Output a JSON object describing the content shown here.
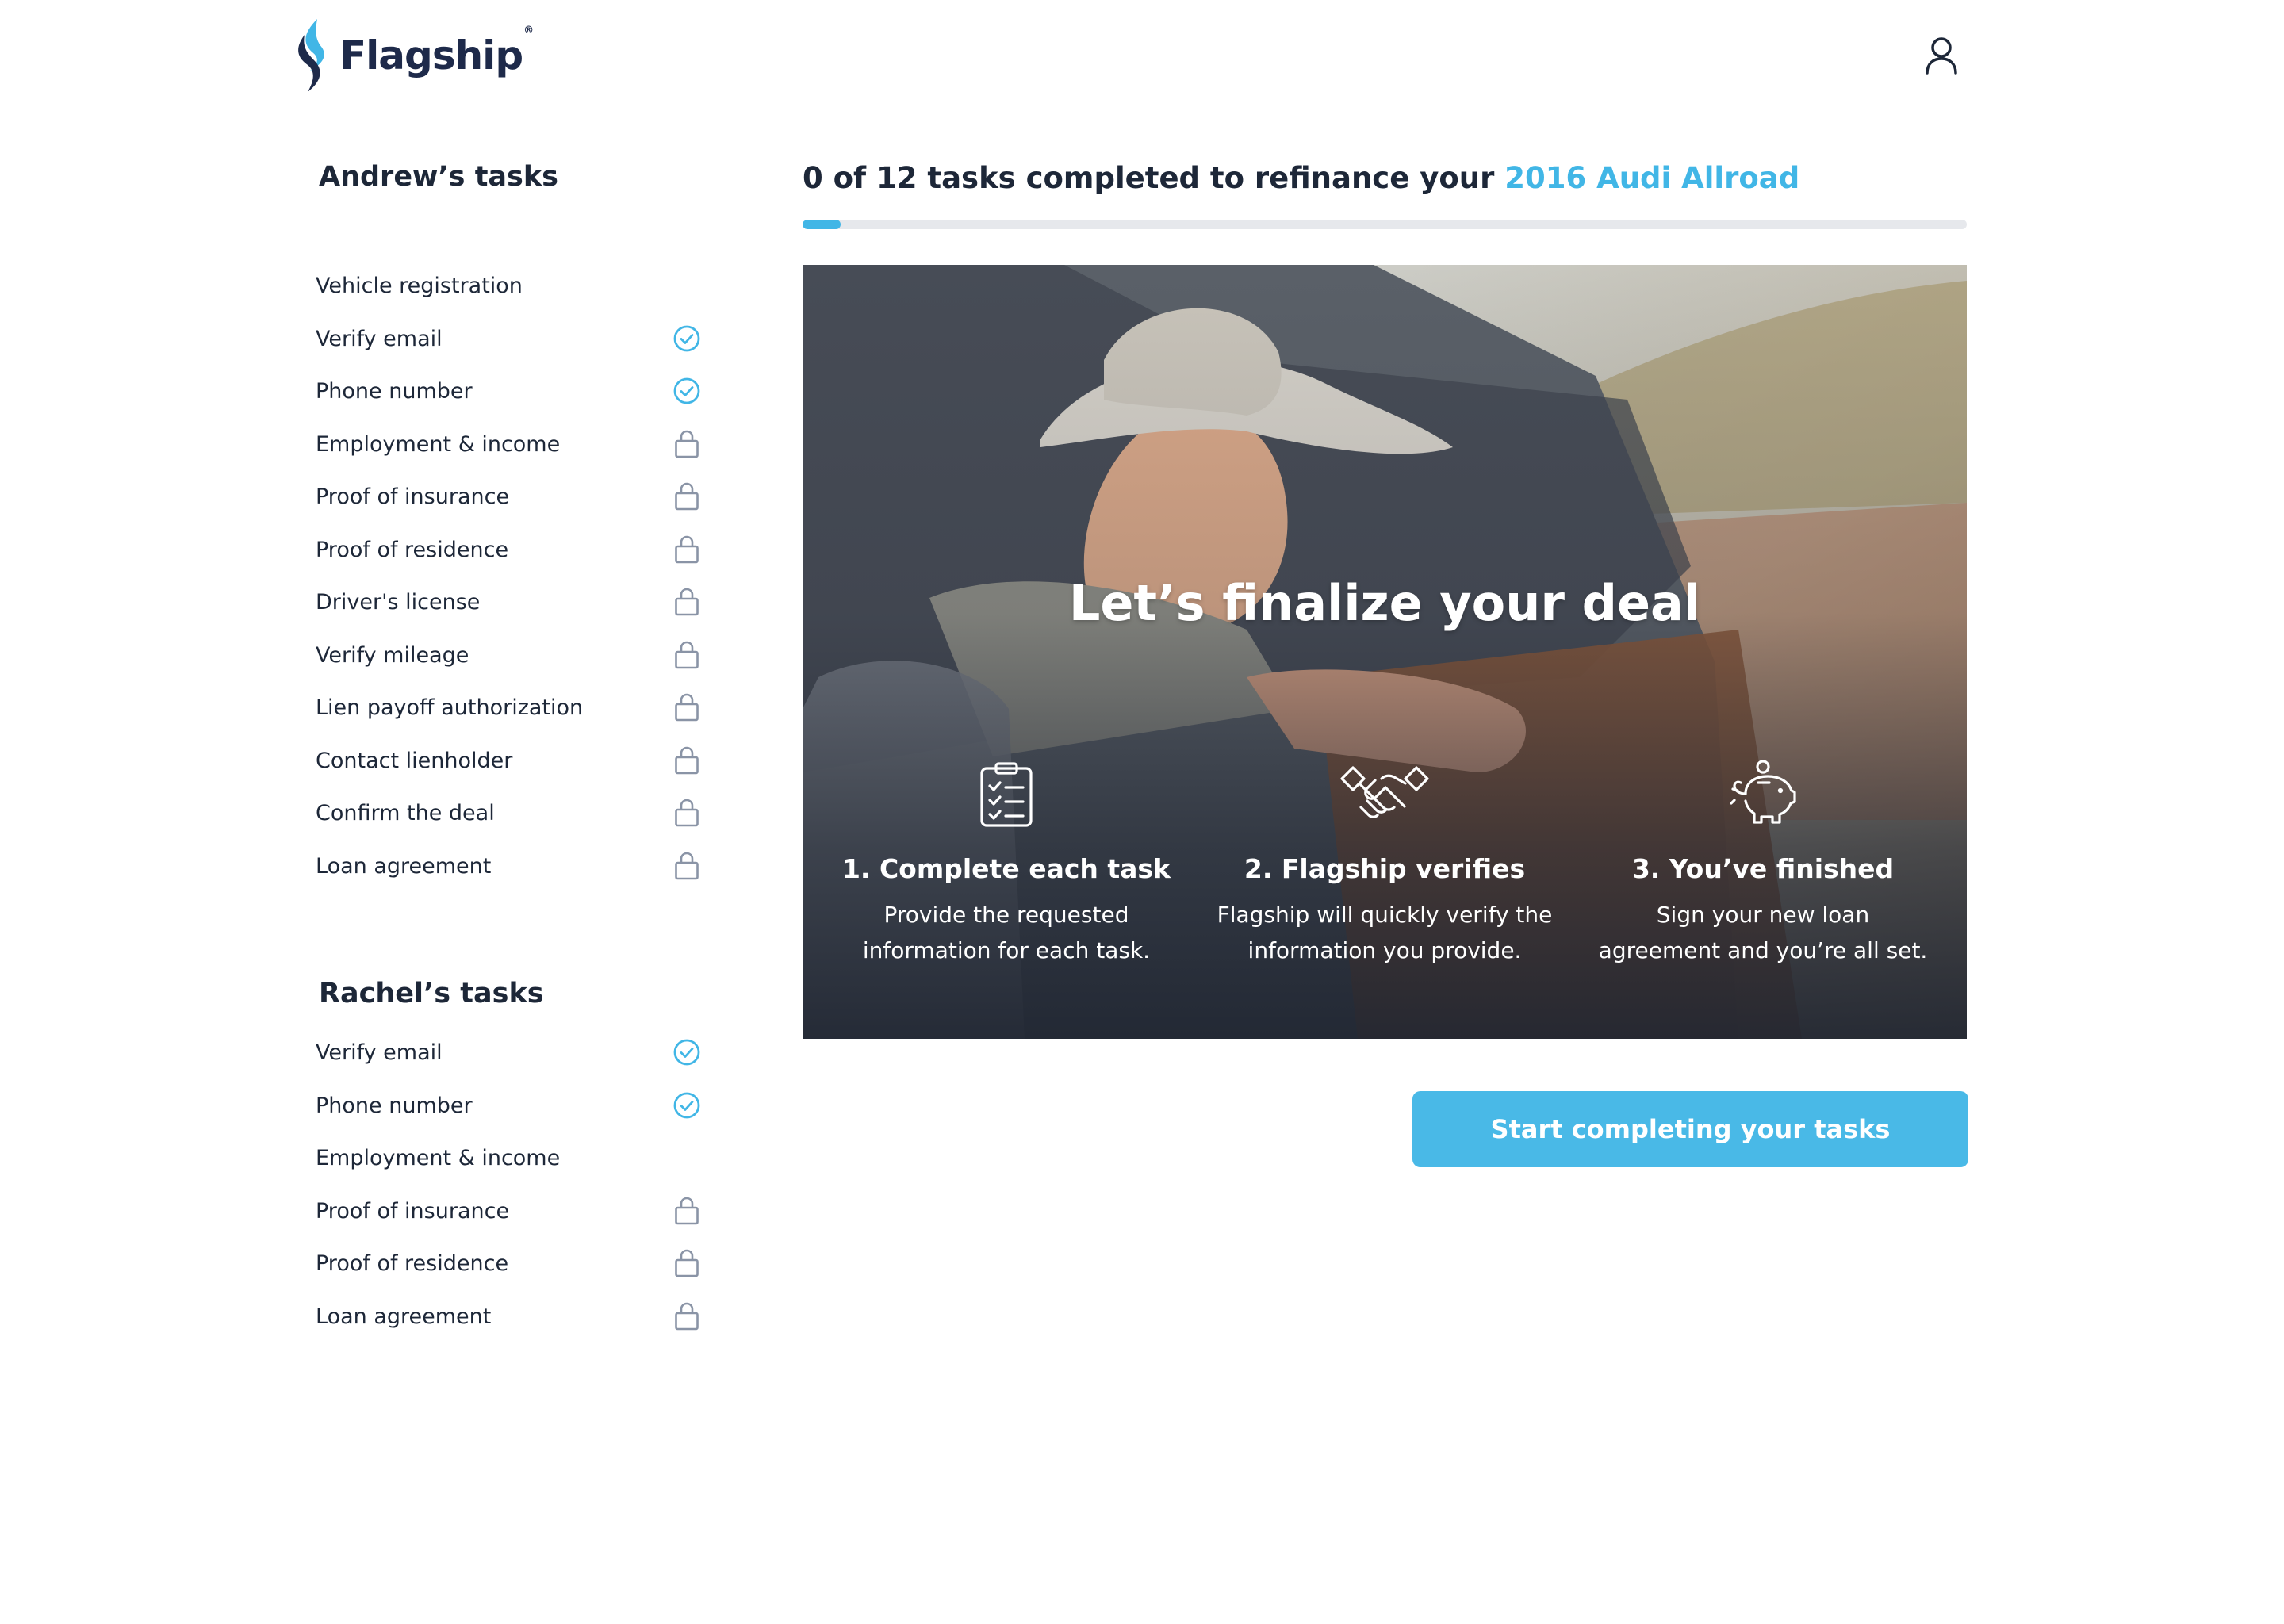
{
  "header": {
    "logo_text": "Flagship",
    "logo_reg": "®",
    "user_icon": "user-icon"
  },
  "colors": {
    "accent": "#41b6e6",
    "text": "#1d2738",
    "check": "#41b6e6",
    "lock": "#8a94a6"
  },
  "sidebar": {
    "groups": [
      {
        "title": "Andrew’s tasks",
        "items": [
          {
            "label": "Vehicle registration",
            "status": "none"
          },
          {
            "label": "Verify email",
            "status": "complete"
          },
          {
            "label": "Phone number",
            "status": "complete"
          },
          {
            "label": "Employment & income",
            "status": "locked"
          },
          {
            "label": "Proof of insurance",
            "status": "locked"
          },
          {
            "label": "Proof of residence",
            "status": "locked"
          },
          {
            "label": "Driver's license",
            "status": "locked"
          },
          {
            "label": "Verify mileage",
            "status": "locked"
          },
          {
            "label": "Lien payoff authorization",
            "status": "locked"
          },
          {
            "label": "Contact lienholder",
            "status": "locked"
          },
          {
            "label": "Confirm the deal",
            "status": "locked"
          },
          {
            "label": "Loan agreement",
            "status": "locked"
          }
        ]
      },
      {
        "title": "Rachel’s tasks",
        "items": [
          {
            "label": "Verify email",
            "status": "complete"
          },
          {
            "label": "Phone number",
            "status": "complete"
          },
          {
            "label": "Employment & income",
            "status": "none"
          },
          {
            "label": "Proof of insurance",
            "status": "locked"
          },
          {
            "label": "Proof of residence",
            "status": "locked"
          },
          {
            "label": "Loan agreement",
            "status": "locked"
          }
        ]
      }
    ]
  },
  "progress": {
    "title_prefix": "0 of 12 tasks completed to refinance your ",
    "vehicle": "2016 Audi Allroad",
    "fraction": 0.033
  },
  "hero": {
    "heading": "Let’s finalize your deal",
    "steps": [
      {
        "icon": "clipboard-checklist-icon",
        "title": "1. Complete each task",
        "desc": "Provide the requested information for each task."
      },
      {
        "icon": "handshake-icon",
        "title": "2. Flagship verifies",
        "desc": "Flagship will quickly verify the information you provide."
      },
      {
        "icon": "piggy-bank-icon",
        "title": "3. You’ve finished",
        "desc": "Sign your new loan agreement and you’re all set."
      }
    ]
  },
  "cta": {
    "label": "Start completing your tasks"
  }
}
